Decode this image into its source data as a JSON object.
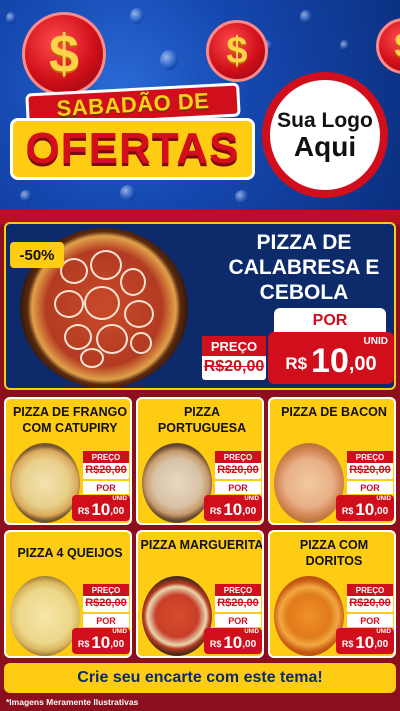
{
  "header": {
    "currency_symbol": "$",
    "title_top": "SABADÃO DE",
    "title_main": "OFERTAS",
    "logo_line1": "Sua Logo",
    "logo_line2": "Aqui"
  },
  "featured": {
    "discount": "-50%",
    "name": "PIZZA DE CALABRESA E CEBOLA",
    "price_label": "PREÇO",
    "old_price": "R$20,00",
    "por_label": "POR",
    "currency": "R$",
    "price_int": "10",
    "price_dec": ",00",
    "unit": "UNID"
  },
  "products": [
    {
      "name": "PIZZA DE FRANGO COM CATUPIRY",
      "price_label": "PREÇO",
      "old_price": "R$20,00",
      "por_label": "POR",
      "currency": "R$",
      "price_int": "10",
      "price_dec": ",00",
      "unit": "UNID"
    },
    {
      "name": "PIZZA PORTUGUESA",
      "price_label": "PREÇO",
      "old_price": "R$20,00",
      "por_label": "POR",
      "currency": "R$",
      "price_int": "10",
      "price_dec": ",00",
      "unit": "UNID"
    },
    {
      "name": "PIZZA DE BACON",
      "price_label": "PREÇO",
      "old_price": "R$20,00",
      "por_label": "POR",
      "currency": "R$",
      "price_int": "10",
      "price_dec": ",00",
      "unit": "UNID"
    },
    {
      "name": "PIZZA 4 QUEIJOS",
      "price_label": "PREÇO",
      "old_price": "R$20,00",
      "por_label": "POR",
      "currency": "R$",
      "price_int": "10",
      "price_dec": ",00",
      "unit": "UNID"
    },
    {
      "name": "PIZZA MARGUERITA",
      "price_label": "PREÇO",
      "old_price": "R$20,00",
      "por_label": "POR",
      "currency": "R$",
      "price_int": "10",
      "price_dec": ",00",
      "unit": "UNID"
    },
    {
      "name": "PIZZA COM DORITOS",
      "price_label": "PREÇO",
      "old_price": "R$20,00",
      "por_label": "POR",
      "currency": "R$",
      "price_int": "10",
      "price_dec": ",00",
      "unit": "UNID"
    }
  ],
  "cta": "Crie seu encarte com este tema!",
  "footnote": "*Imagens Meramente Ilustrativas",
  "colors": {
    "yellow": "#ffcc14",
    "red": "#d10f1c",
    "navy": "#0d2a6b"
  }
}
